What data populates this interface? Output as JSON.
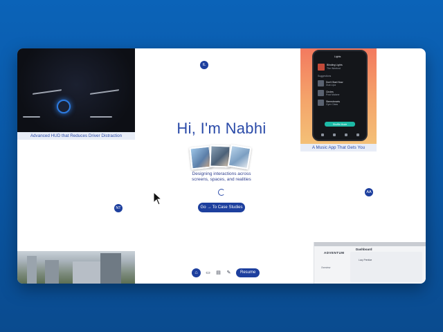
{
  "hero": {
    "title": "Hi, I'm Nabhi",
    "subtitle_line1": "Designing interactions across",
    "subtitle_line2": "screens, spaces, and realities",
    "cta_label": "Go → To Case Studies"
  },
  "avatars": {
    "il": "IL",
    "nt": "NT",
    "aa": "AA"
  },
  "cards": {
    "hud_caption": "Advanced HUD that Reduces Driver Distraction",
    "music_caption": "A Music App That Gets You",
    "music_phone": {
      "header": "Lights",
      "track_title": "Blinding Lights",
      "track_artist": "The Weeknd",
      "section": "Suggestions",
      "rows": [
        {
          "title": "Don't Start Now",
          "artist": "Dua Lipa"
        },
        {
          "title": "Circles",
          "artist": "Post Malone"
        },
        {
          "title": "Stereohearts",
          "artist": "Gym Class"
        }
      ],
      "button_label": "Shuffle Mode"
    },
    "dashboard": {
      "logo": "ADVENTUM",
      "title": "Dashboard",
      "subtitle": "Lucy Prentice",
      "nav_item": "Overview"
    }
  },
  "dock": {
    "home_icon": "home-icon",
    "resume_label": "Resume"
  }
}
